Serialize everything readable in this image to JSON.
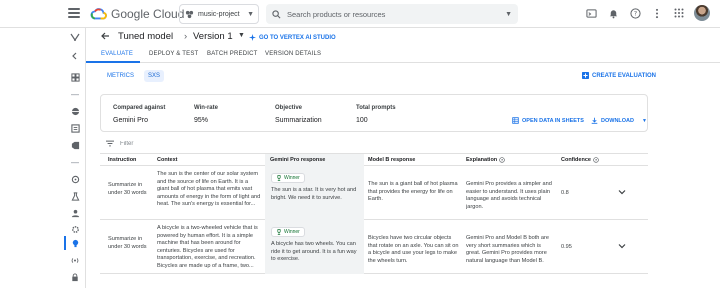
{
  "topbar": {
    "brand": "Google Cloud",
    "project": "music-project",
    "search_placeholder": "Search products or resources"
  },
  "header": {
    "title": "Tuned model",
    "version": "Version 1",
    "goto_label": "GO TO VERTEX AI STUDIO"
  },
  "tabs": [
    {
      "label": "EVALUATE",
      "active": true
    },
    {
      "label": "DEPLOY & TEST"
    },
    {
      "label": "BATCH PREDICT"
    },
    {
      "label": "VERSION DETAILS"
    }
  ],
  "views": {
    "metrics": "METRICS",
    "sxs": "SXS",
    "create": "CREATE EVALUATION"
  },
  "summary": {
    "compared_label": "Compared against",
    "compared_value": "Gemini Pro",
    "winrate_label": "Win-rate",
    "winrate_value": "95%",
    "objective_label": "Objective",
    "objective_value": "Summarization",
    "prompts_label": "Total prompts",
    "prompts_value": "100",
    "open_sheets": "OPEN DATA IN SHEETS",
    "download": "DOWNLOAD"
  },
  "filter": {
    "placeholder": "Filter"
  },
  "table": {
    "columns": {
      "instruction": "Instruction",
      "context": "Context",
      "gemini": "Gemini Pro response",
      "modelb": "Model B response",
      "explanation": "Explanation",
      "confidence": "Confidence"
    },
    "winner_label": "Winner",
    "rows": [
      {
        "instruction": "Summarize in under 30 words",
        "context": "The sun is the center of our solar system and the source of life on Earth. It is a giant ball of hot plasma that emits vast amounts of energy in the form of light and heat. The sun's energy is essential for...",
        "gemini": "The sun is a star. It is very hot and bright. We need it to survive.",
        "modelb": "The sun is a giant ball of hot plasma that provides the energy for life on Earth.",
        "explanation": "Gemini Pro provides a simpler and easier to understand. It uses plain language and avoids technical jargon.",
        "confidence": "0.8"
      },
      {
        "instruction": "Summarize in under 30 words",
        "context": "A bicycle is a two-wheeled vehicle that is powered by human effort. It is a simple machine that has been around for centuries. Bicycles are used for transportation, exercise, and recreation. Bicycles are made up of a frame, two...",
        "gemini": "A bicycle has two wheels. You can ride it to get around. It is a fun way to exercise.",
        "modelb": "Bicycles have two circular objects that rotate on an axle. You can sit on a bicycle and use your legs to make the wheels turn.",
        "explanation": "Gemini Pro and Model B both are very short summaries which is great. Gemini Pro provides more natural language than Model B.",
        "confidence": "0.95"
      }
    ]
  },
  "colors": {
    "accent": "#1a73e8",
    "winner": "#137333",
    "highlight": "#f1f3f4"
  }
}
